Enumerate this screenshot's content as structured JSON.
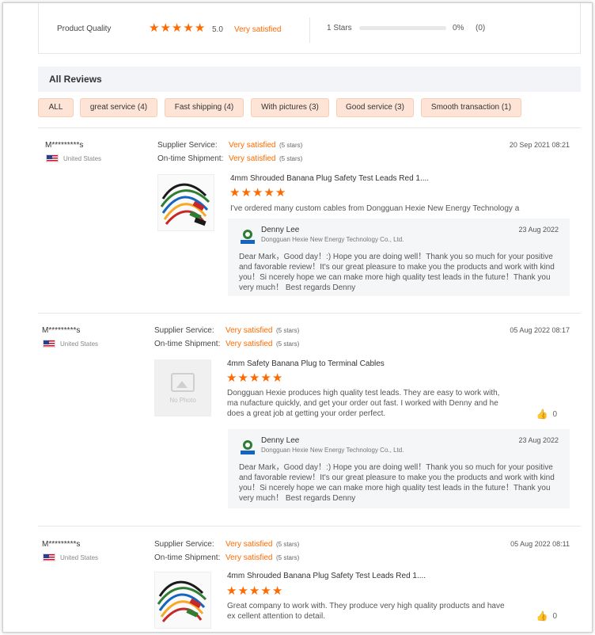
{
  "summary": {
    "label": "Product Quality",
    "score": "5.0",
    "satisfaction": "Very satisfied",
    "stars_value": 5,
    "dist_label": "1  Stars",
    "dist_fraction": 0,
    "dist_pct": "0%",
    "dist_count": "(0)"
  },
  "header": {
    "title": "All Reviews"
  },
  "filters": [
    "ALL",
    "great service (4)",
    "Fast shipping (4)",
    "With pictures (3)",
    "Good service (3)",
    "Smooth transaction (1)"
  ],
  "labels": {
    "supplier_service": "Supplier Service:",
    "ontime_shipment": "On-time Shipment:",
    "stars_suffix": "(5 stars)",
    "no_photo": "No Photo"
  },
  "colors": {
    "accent": "#ff6a00",
    "chip_bg": "#fde4d6"
  },
  "reviews": [
    {
      "reviewer": "M*********s",
      "country": "United States",
      "supplier_service": "Very satisfied",
      "ontime_shipment": "Very satisfied",
      "date": "20 Sep 2021 08:21",
      "product_title": "4mm Shrouded Banana Plug Safety Test Leads Red 1....",
      "text": "I've ordered many custom cables from Dongguan Hexie New Energy Technology a",
      "has_photo": true,
      "likes": "",
      "reply": {
        "name": "Denny Lee",
        "company": "Dongguan Hexie New Energy Technology Co., Ltd.",
        "date": "23 Aug 2022",
        "text": "Dear Mark，Good day！:) Hope you are doing well！Thank you so much for your positive and favorable review！It's our great pleasure to make you the products and work with kind you！Si ncerely hope we can make more high quality test leads in the future！Thank you very much！ Best regards Denny"
      }
    },
    {
      "reviewer": "M*********s",
      "country": "United States",
      "supplier_service": "Very satisfied",
      "ontime_shipment": "Very satisfied",
      "date": "05 Aug 2022 08:17",
      "product_title": "4mm Safety Banana Plug to Terminal Cables",
      "text": "Dongguan Hexie produces high quality test leads. They are easy to work with, ma nufacture quickly, and get your order out fast. I worked with Denny and he does a great job at getting your order perfect.",
      "has_photo": false,
      "likes": "0",
      "reply": {
        "name": "Denny Lee",
        "company": "Dongguan Hexie New Energy Technology Co., Ltd.",
        "date": "23 Aug 2022",
        "text": "Dear Mark，Good day！:) Hope you are doing well！Thank you so much for your positive and favorable review！It's our great pleasure to make you the products and work with kind you！Si ncerely hope we can make more high quality test leads in the future！Thank you very much！ Best regards Denny"
      }
    },
    {
      "reviewer": "M*********s",
      "country": "United States",
      "supplier_service": "Very satisfied",
      "ontime_shipment": "Very satisfied",
      "date": "05 Aug 2022 08:11",
      "product_title": "4mm Shrouded Banana Plug Safety Test Leads Red 1....",
      "text": "Great company to work with. They produce very high quality products and have ex cellent attention to detail.",
      "has_photo": true,
      "likes": "0"
    }
  ]
}
